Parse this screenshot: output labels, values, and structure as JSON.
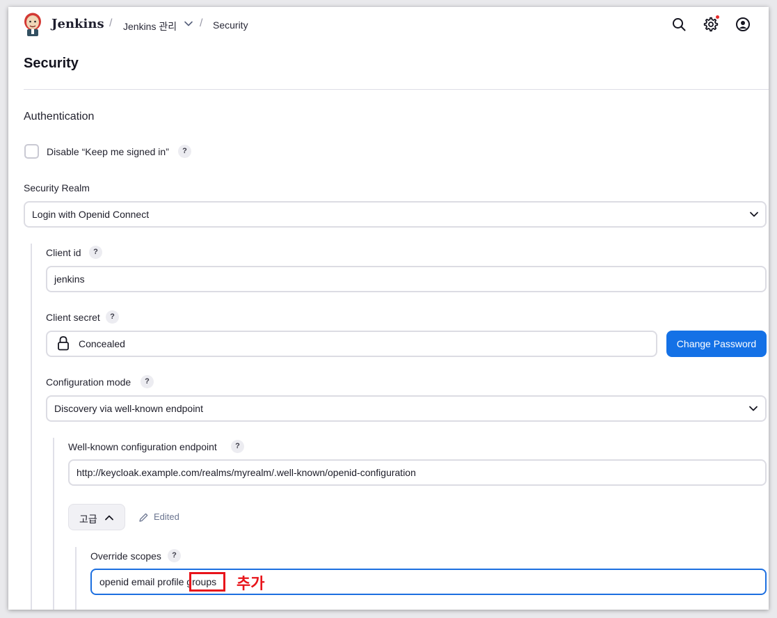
{
  "header": {
    "brand": "Jenkins",
    "breadcrumb": [
      "Jenkins 관리",
      "Security"
    ],
    "separator": "/"
  },
  "page": {
    "title": "Security",
    "section_title": "Authentication"
  },
  "authentication": {
    "disable_keep_signed_in_label": "Disable “Keep me signed in”",
    "disable_keep_signed_in_checked": false,
    "security_realm_label": "Security Realm",
    "security_realm_value": "Login with Openid Connect"
  },
  "oidc": {
    "client_id_label": "Client id",
    "client_id_value": "jenkins",
    "client_secret_label": "Client secret",
    "client_secret_value": "Concealed",
    "change_password_label": "Change Password",
    "config_mode_label": "Configuration mode",
    "config_mode_value": "Discovery via well-known endpoint",
    "wellknown_label": "Well-known configuration endpoint",
    "wellknown_value": "http://keycloak.example.com/realms/myrealm/.well-known/openid-configuration",
    "advanced_label": "고급",
    "edited_label": "Edited",
    "override_scopes_label": "Override scopes",
    "override_scopes_value": "openid email profile groups",
    "override_scopes_prefix": "openid email profile ",
    "override_scopes_highlight": "groups"
  },
  "annotation": {
    "text": "추가",
    "color": "#e8141a"
  },
  "help_mark": "?",
  "colors": {
    "primary": "#1471e6",
    "notification_dot": "#e52b2b",
    "focus_border": "#1c6fe0"
  }
}
